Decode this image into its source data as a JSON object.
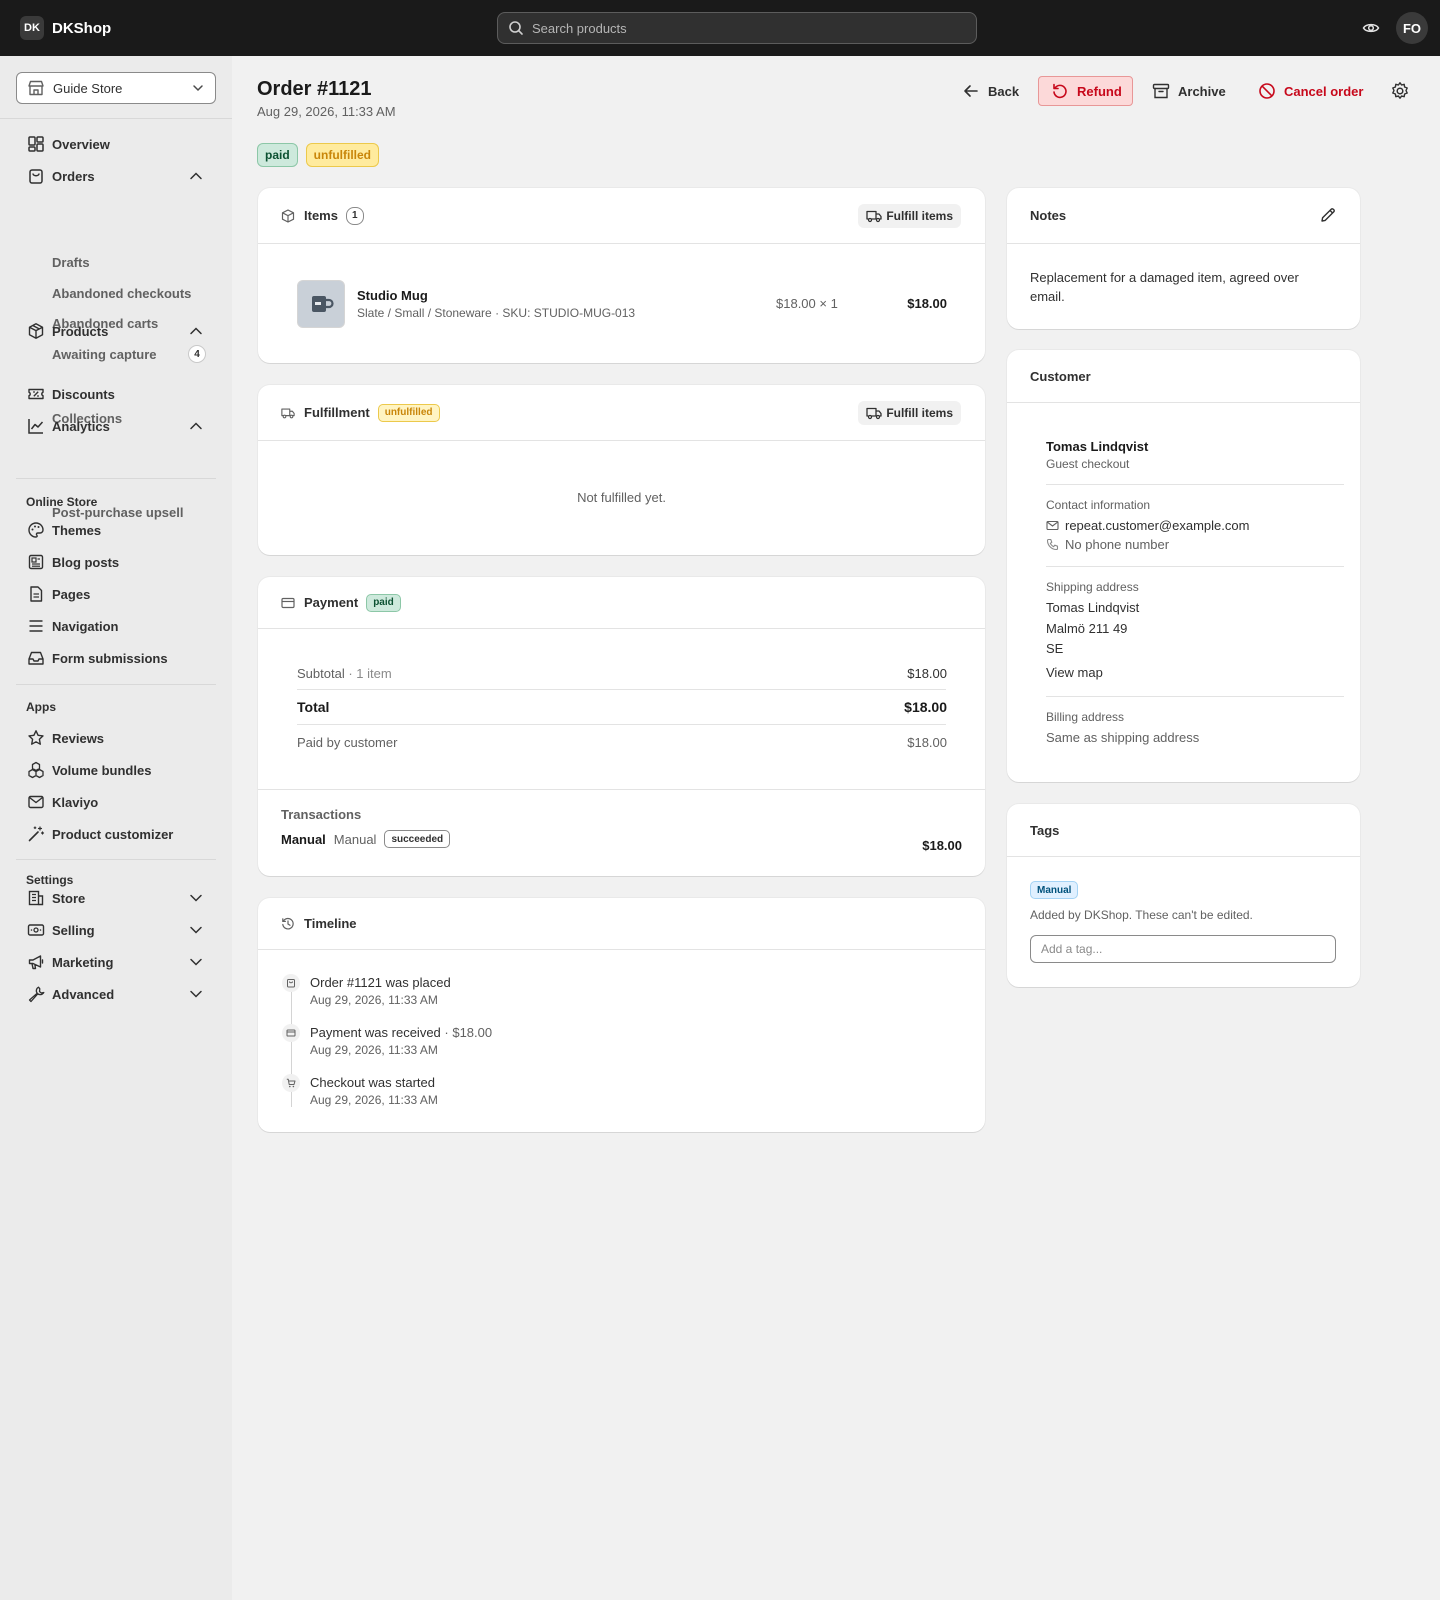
{
  "topbar": {
    "logo_abbr": "DK",
    "brand": "DKShop",
    "search_placeholder": "Search products",
    "avatar_initials": "FO"
  },
  "sidebar": {
    "store_name": "Guide Store",
    "items": {
      "overview": "Overview",
      "orders": "Orders",
      "drafts": "Drafts",
      "abandoned_checkouts": "Abandoned checkouts",
      "abandoned_carts": "Abandoned carts",
      "awaiting_capture": "Awaiting capture",
      "awaiting_capture_count": "4",
      "products": "Products",
      "collections": "Collections",
      "discounts": "Discounts",
      "analytics": "Analytics",
      "post_purchase_upsell": "Post-purchase upsell"
    },
    "online_store": {
      "label": "Online Store",
      "themes": "Themes",
      "blog_posts": "Blog posts",
      "pages": "Pages",
      "navigation": "Navigation",
      "form_submissions": "Form submissions"
    },
    "apps": {
      "label": "Apps",
      "reviews": "Reviews",
      "volume_bundles": "Volume bundles",
      "klaviyo": "Klaviyo",
      "product_customizer": "Product customizer"
    },
    "settings": {
      "label": "Settings",
      "store": "Store",
      "selling": "Selling",
      "marketing": "Marketing",
      "advanced": "Advanced"
    }
  },
  "header": {
    "title": "Order #1121",
    "date": "Aug 29, 2026, 11:33 AM",
    "back": "Back",
    "refund": "Refund",
    "archive": "Archive",
    "cancel_order": "Cancel order",
    "badges": {
      "paid": "paid",
      "unfulfilled": "unfulfilled"
    }
  },
  "items_card": {
    "title": "Items",
    "count": "1",
    "fulfill_btn": "Fulfill items",
    "line_item": {
      "name": "Studio Mug",
      "variant": "Slate / Small / Stoneware · SKU: STUDIO-MUG-013",
      "price_qty": "$18.00 × 1",
      "total": "$18.00"
    }
  },
  "fulfillment_card": {
    "title": "Fulfillment",
    "badge": "unfulfilled",
    "fulfill_btn": "Fulfill items",
    "empty": "Not fulfilled yet."
  },
  "payment_card": {
    "title": "Payment",
    "badge": "paid",
    "subtotal_label": "Subtotal",
    "subtotal_count": "· 1 item",
    "subtotal_value": "$18.00",
    "total_label": "Total",
    "total_value": "$18.00",
    "paid_label": "Paid by customer",
    "paid_value": "$18.00",
    "transactions_label": "Transactions",
    "txn_gateway": "Manual",
    "txn_kind": "Manual",
    "txn_status": "succeeded",
    "txn_amount": "$18.00"
  },
  "timeline_card": {
    "title": "Timeline",
    "events": [
      {
        "text": "Order #1121 was placed",
        "extra": "",
        "time": "Aug 29, 2026, 11:33 AM"
      },
      {
        "text": "Payment was received",
        "extra": "· $18.00",
        "time": "Aug 29, 2026, 11:33 AM"
      },
      {
        "text": "Checkout was started",
        "extra": "",
        "time": "Aug 29, 2026, 11:33 AM"
      }
    ]
  },
  "notes_card": {
    "title": "Notes",
    "body": "Replacement for a damaged item, agreed over email."
  },
  "customer_card": {
    "title": "Customer",
    "name": "Tomas Lindqvist",
    "type": "Guest checkout",
    "contact_label": "Contact information",
    "email": "repeat.customer@example.com",
    "phone": "No phone number",
    "shipping_label": "Shipping address",
    "ship_name": "Tomas Lindqvist",
    "ship_city": "Malmö 211 49",
    "ship_country": "SE",
    "view_map": "View map",
    "billing_label": "Billing address",
    "billing_value": "Same as shipping address"
  },
  "tags_card": {
    "title": "Tags",
    "tag": "Manual",
    "note": "Added by DKShop. These can't be edited.",
    "input_placeholder": "Add a tag..."
  },
  "colors": {
    "topbar": "#1a1a1a",
    "critical": "#c7081b",
    "success_bg": "#cde9dc",
    "warning_bg": "#ffeb9e"
  }
}
